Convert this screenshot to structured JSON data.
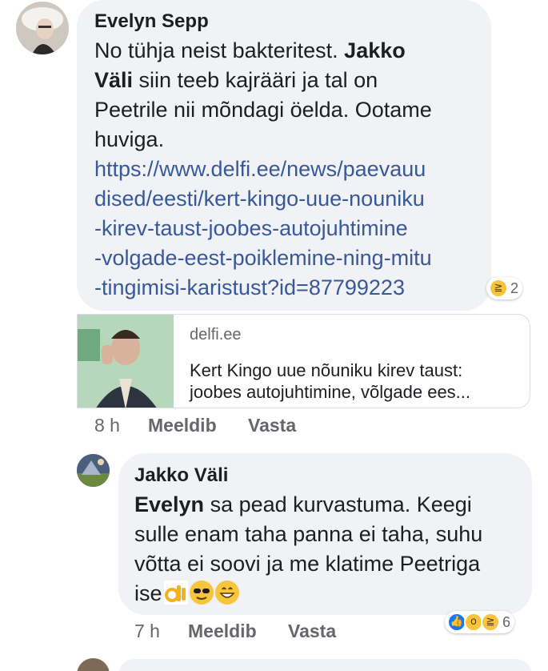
{
  "comment1": {
    "author": "Evelyn Sepp",
    "text_line1": "No tühja neist bakteritest. ",
    "mention_part1": "Jakko",
    "mention_part2": "Väli",
    "text_line2_rest": " siin teeb kajrääri ja tal on",
    "text_line3": "Peetrile nii  mõndagi öelda. Ootame",
    "text_line4": "huviga.",
    "link_lines": [
      "https://www.delfi.ee/news/paevauu",
      "dised/eesti/kert-kingo-uue-nouniku",
      "-kirev-taust-joobes-autojuhtimine",
      "-volgade-eest-poiklemine-ning-mitu",
      "-tingimisi-karistust?id=87799223"
    ],
    "reaction_count": "2",
    "reaction_icon": "laugh-emoji-icon",
    "preview": {
      "domain": "delfi.ee",
      "title_line1": "Kert Kingo uue nõuniku kirev taust:",
      "title_line2": "joobes autojuhtimine, võlgade ees..."
    },
    "time": "8 h",
    "like_label": "Meeldib",
    "reply_label": "Vasta"
  },
  "comment2": {
    "author": "Jakko Väli",
    "mention": "Evelyn",
    "text_line1_rest": " sa pead kurvastuma. Keegi",
    "text_line2": "sulle enam taha panna ei taha, suhu",
    "text_line3": "võtta ei soovi ja me klatime Peetriga",
    "text_line4": "ise",
    "inline_emojis": [
      "ok-hand-emoji-icon",
      "sunglasses-emoji-icon",
      "grin-emoji-icon"
    ],
    "reaction_icons": [
      "like-icon",
      "wow-emoji-icon",
      "laugh-emoji-icon"
    ],
    "reaction_count": "6",
    "time": "7 h",
    "like_label": "Meeldib",
    "reply_label": "Vasta"
  },
  "colors": {
    "bubble": "#f0f2f5",
    "link": "#385898",
    "meta": "#65676b",
    "like_blue": "#1877f2",
    "emoji_yellow": "#f7c53b"
  }
}
